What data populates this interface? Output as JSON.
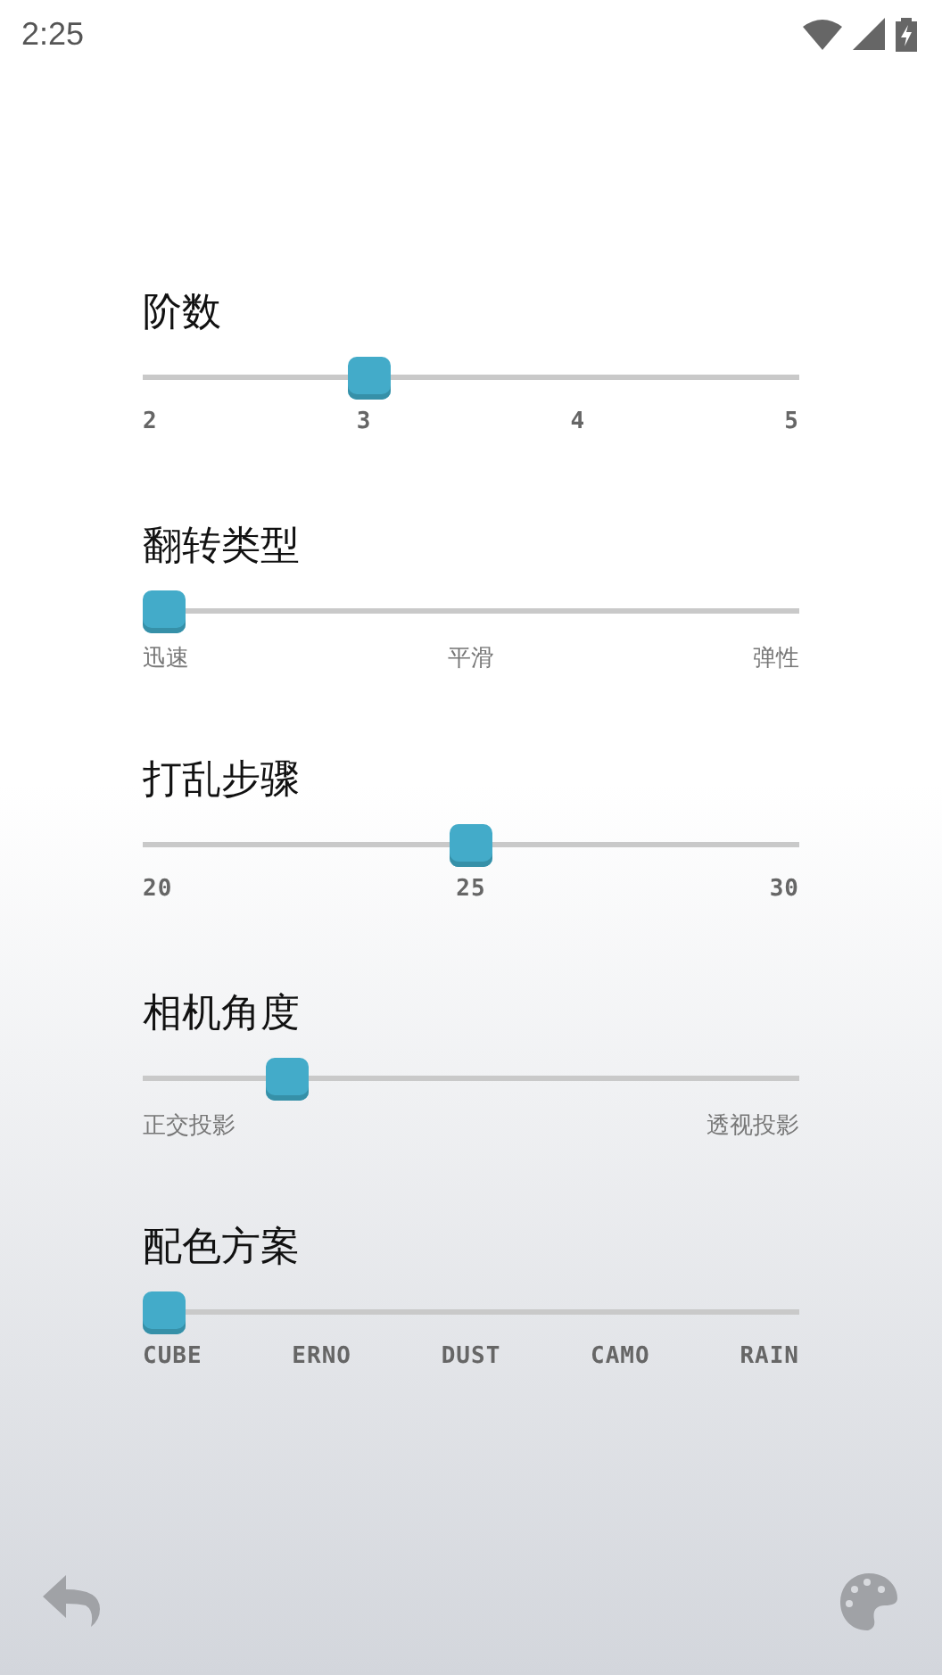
{
  "status_bar": {
    "time": "2:25"
  },
  "settings": [
    {
      "title": "阶数",
      "kind": "display",
      "level": 0.333,
      "ticks": [
        "2",
        "3",
        "4",
        "5"
      ]
    },
    {
      "title": "翻转类型",
      "kind": "plain",
      "level": 0,
      "ticks": [
        "迅速",
        "平滑",
        "弹性"
      ]
    },
    {
      "title": "打乱步骤",
      "kind": "display",
      "level": 0.5,
      "ticks": [
        "20",
        "25",
        "30"
      ]
    },
    {
      "title": "相机角度",
      "kind": "plain",
      "level": 0.2,
      "ticks": [
        "正交投影",
        "透视投影"
      ]
    },
    {
      "title": "配色方案",
      "kind": "display",
      "level": 0,
      "ticks": [
        "CUBE",
        "ERNO",
        "DUST",
        "CAMO",
        "RAIN"
      ]
    }
  ]
}
